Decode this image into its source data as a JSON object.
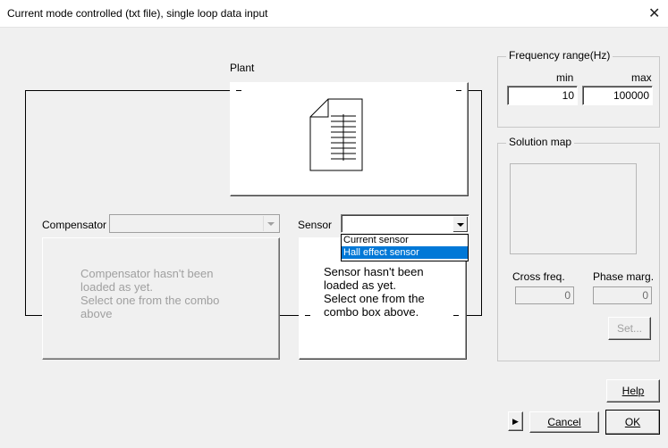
{
  "window": {
    "title": "Current mode controlled (txt file), single loop data input",
    "close_glyph": "✕"
  },
  "plant": {
    "label": "Plant",
    "icon": "document-icon"
  },
  "compensator": {
    "label": "Compensator",
    "selected": "",
    "message": "Compensator hasn't been\nloaded as yet.\nSelect one from the combo\nabove"
  },
  "sensor": {
    "label": "Sensor",
    "selected": "",
    "options": [
      "Current sensor",
      "Hall effect sensor"
    ],
    "highlighted_option": "Hall effect sensor",
    "message": "Sensor hasn't been\nloaded as yet.\nSelect one from the\ncombo box above."
  },
  "frequency": {
    "group_label": "Frequency range(Hz)",
    "min_label": "min",
    "max_label": "max",
    "min_value": "10",
    "max_value": "100000"
  },
  "solution_map": {
    "group_label": "Solution map",
    "cross_freq_label": "Cross freq.",
    "phase_marg_label": "Phase marg.",
    "cross_freq_value": "0",
    "phase_marg_value": "0",
    "set_label": "Set..."
  },
  "buttons": {
    "help_label": "Help",
    "cancel_label": "Cancel",
    "ok_label": "OK",
    "play_glyph": "▶"
  },
  "colors": {
    "highlight": "#0078d7"
  }
}
